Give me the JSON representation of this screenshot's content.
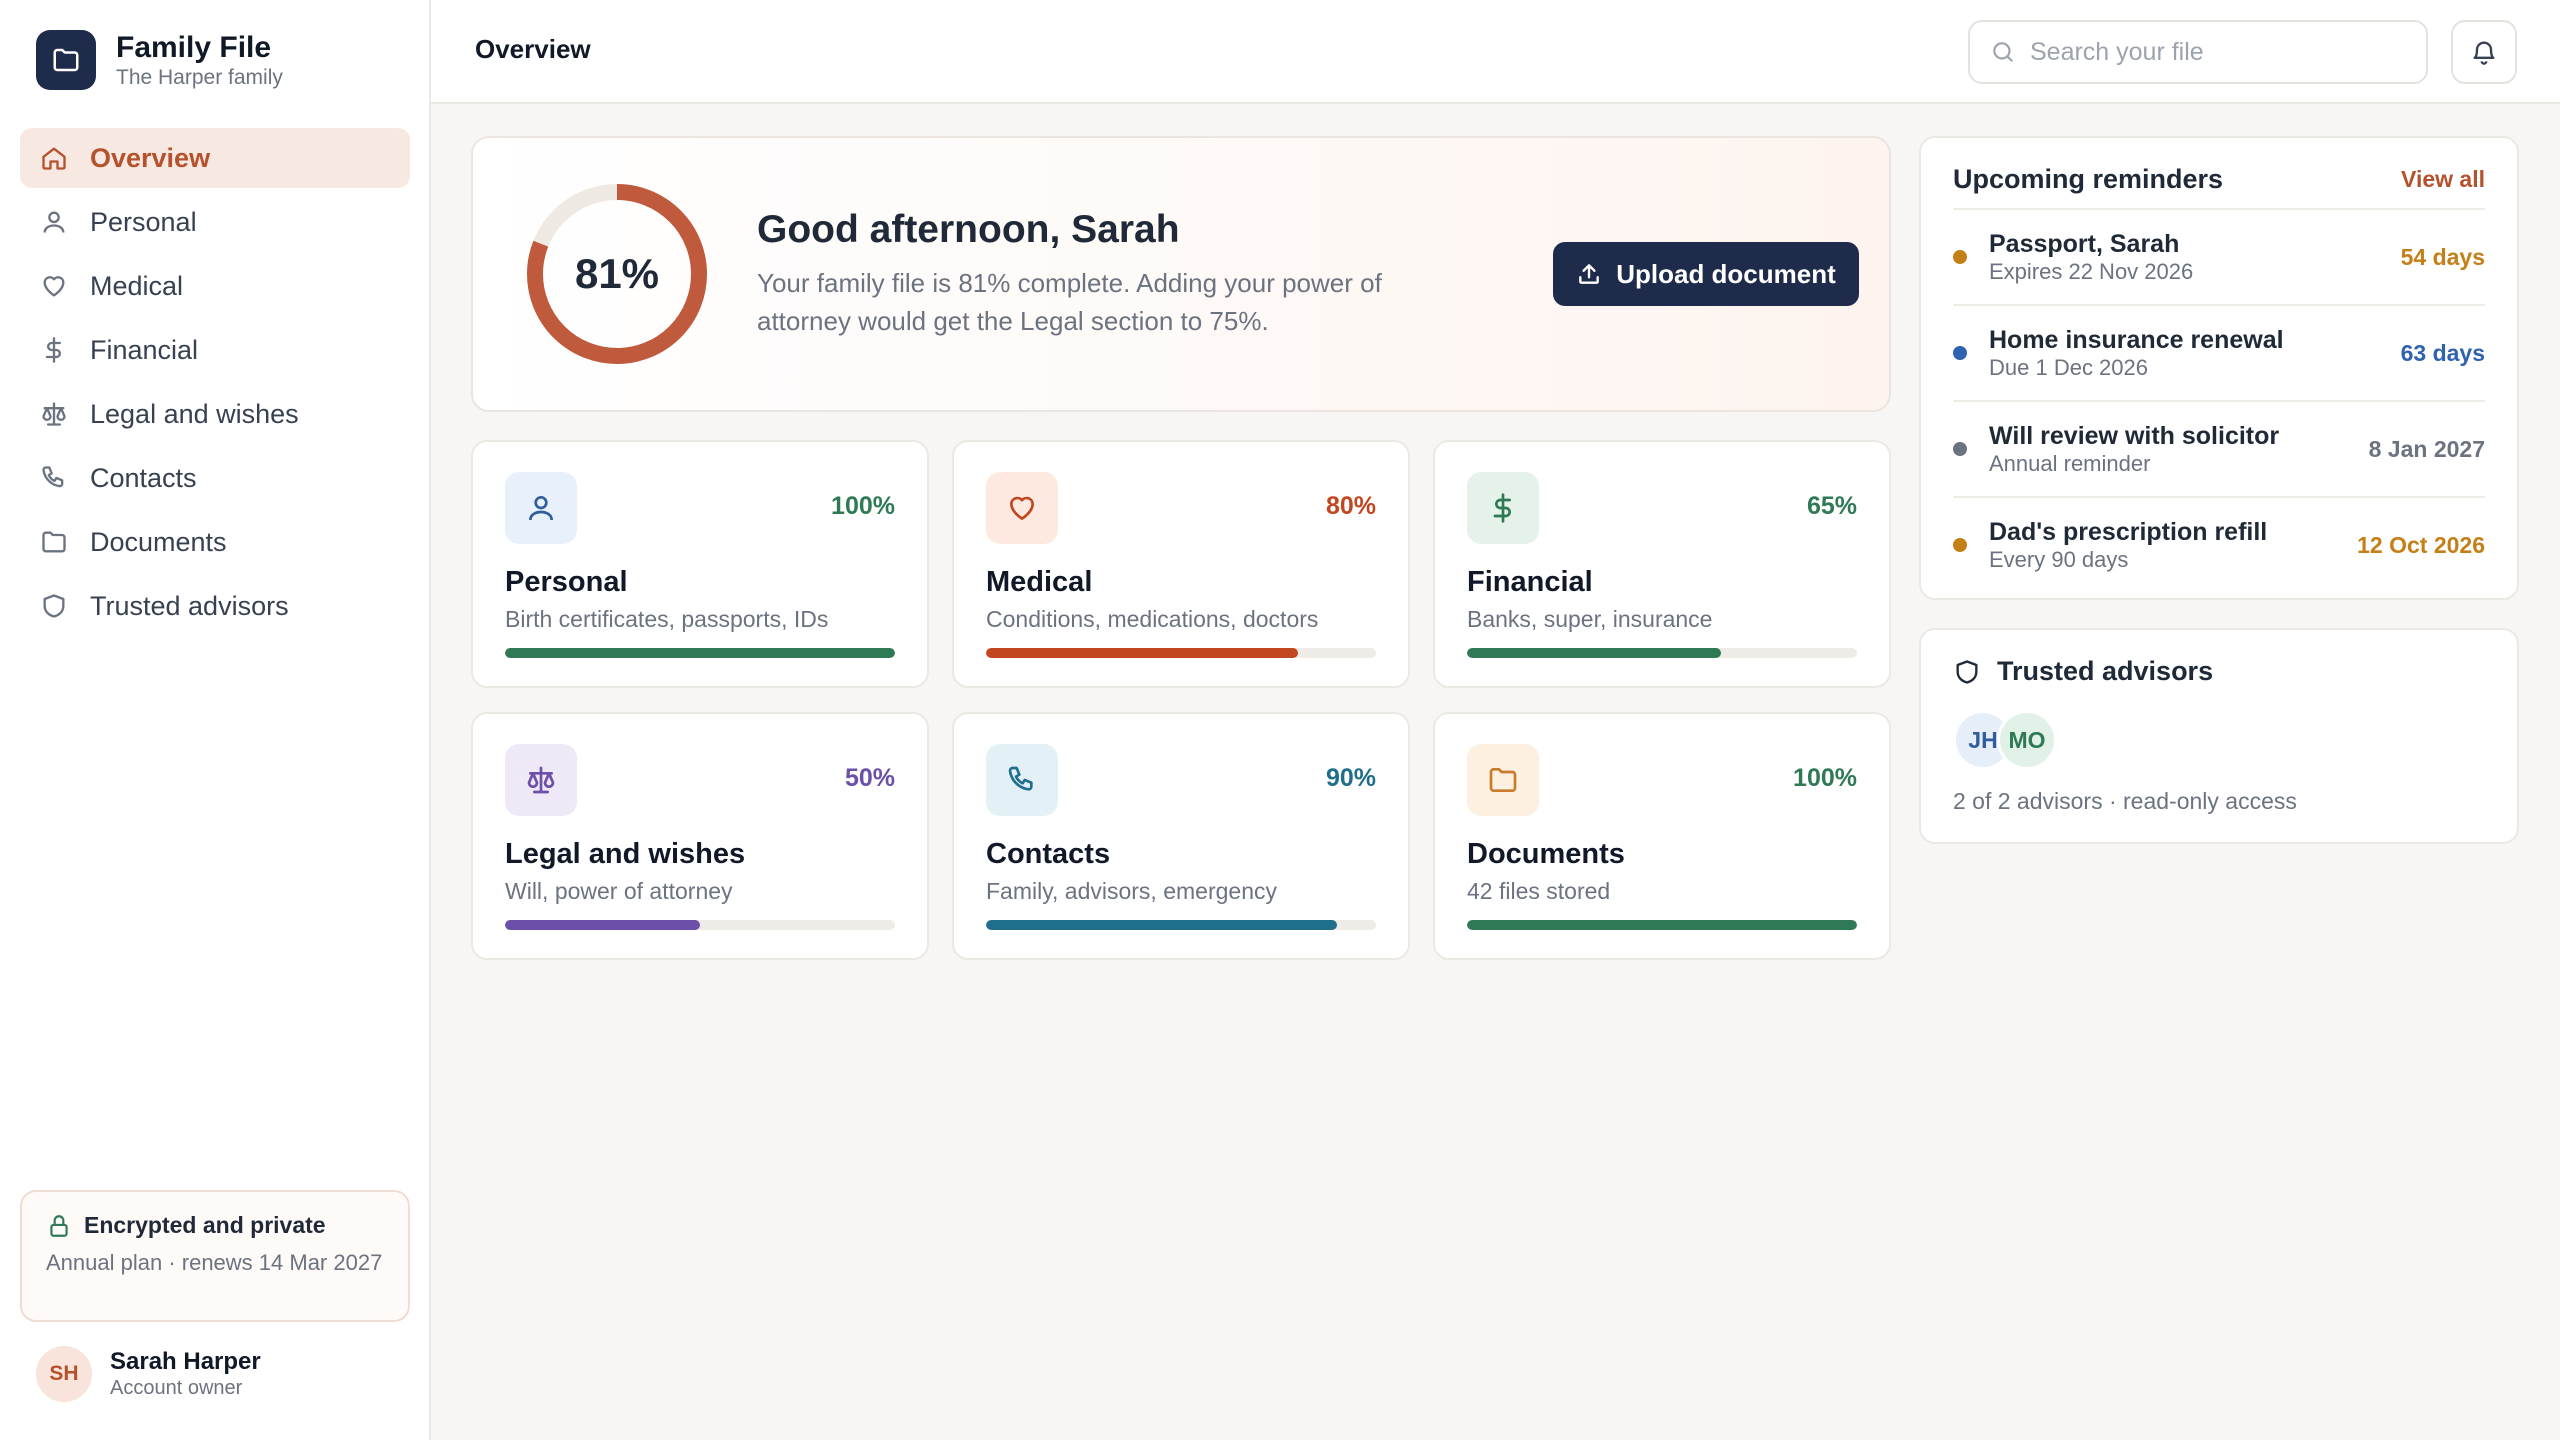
{
  "app": {
    "title": "Family File",
    "subtitle": "The Harper family"
  },
  "nav": [
    {
      "label": "Overview",
      "icon": "home-icon",
      "active": true
    },
    {
      "label": "Personal",
      "icon": "user-icon"
    },
    {
      "label": "Medical",
      "icon": "heart-icon"
    },
    {
      "label": "Financial",
      "icon": "dollar-icon"
    },
    {
      "label": "Legal and wishes",
      "icon": "scales-icon"
    },
    {
      "label": "Contacts",
      "icon": "phone-icon"
    },
    {
      "label": "Documents",
      "icon": "folder-icon"
    },
    {
      "label": "Trusted advisors",
      "icon": "shield-icon"
    }
  ],
  "security": {
    "title": "Encrypted and private",
    "subtitle": "Annual plan · renews 14 Mar 2027"
  },
  "user": {
    "initials": "SH",
    "name": "Sarah Harper",
    "role": "Account owner"
  },
  "topbar": {
    "title": "Overview",
    "search_placeholder": "Search your file"
  },
  "hero": {
    "completion_label": "81%",
    "completion_value": 81,
    "greeting": "Good afternoon, Sarah",
    "message": "Your family file is 81% complete. Adding your power of attorney would get the Legal section to 75%.",
    "upload_label": "Upload document",
    "accent": "#bf5a3c"
  },
  "sections": [
    {
      "title": "Personal",
      "subtitle": "Birth certificates, passports, IDs",
      "percent_label": "100%",
      "percent": 100,
      "color": "#2f7a55",
      "icon_bg": "#e8f0fb",
      "icon_color": "#2f5d9e",
      "icon": "user-icon"
    },
    {
      "title": "Medical",
      "subtitle": "Conditions, medications, doctors",
      "percent_label": "80%",
      "percent": 80,
      "color": "#c2461f",
      "icon_bg": "#fde9e0",
      "icon_color": "#c2461f",
      "icon": "heart-icon"
    },
    {
      "title": "Financial",
      "subtitle": "Banks, super, insurance",
      "percent_label": "65%",
      "percent": 65,
      "color": "#2f7a55",
      "icon_bg": "#e4f2ea",
      "icon_color": "#2f7a55",
      "icon": "dollar-icon"
    },
    {
      "title": "Legal and wishes",
      "subtitle": "Will, power of attorney",
      "percent_label": "50%",
      "percent": 50,
      "color": "#6b4fa8",
      "icon_bg": "#eee8f7",
      "icon_color": "#6b4fa8",
      "icon": "scales-icon"
    },
    {
      "title": "Contacts",
      "subtitle": "Family, advisors, emergency",
      "percent_label": "90%",
      "percent": 90,
      "color": "#1f6e8c",
      "icon_bg": "#e3f1f6",
      "icon_color": "#1f6e8c",
      "icon": "phone-icon"
    },
    {
      "title": "Documents",
      "subtitle": "42 files stored",
      "percent_label": "100%",
      "percent": 100,
      "color": "#2f7a55",
      "icon_bg": "#fdf0e0",
      "icon_color": "#c97a2a",
      "icon": "folder-icon"
    }
  ],
  "reminders": {
    "title": "Upcoming reminders",
    "view_all": "View all",
    "items": [
      {
        "title": "Passport, Sarah",
        "sub": "Expires 22 Nov 2026",
        "due": "54 days",
        "color": "#c47f17"
      },
      {
        "title": "Home insurance renewal",
        "sub": "Due 1 Dec 2026",
        "due": "63 days",
        "color": "#2f62b0"
      },
      {
        "title": "Will review with solicitor",
        "sub": "Annual reminder",
        "due": "8 Jan 2027",
        "color": "#6b7280"
      },
      {
        "title": "Dad's prescription refill",
        "sub": "Every 90 days",
        "due": "12 Oct 2026",
        "color": "#c47f17"
      }
    ]
  },
  "advisors": {
    "title": "Trusted advisors",
    "people": [
      {
        "initials": "JH",
        "bg": "#e6eefa",
        "color": "#2f5d9e"
      },
      {
        "initials": "MO",
        "bg": "#e2f1e8",
        "color": "#2f7a55"
      }
    ],
    "summary": "2 of 2 advisors · read-only access"
  }
}
